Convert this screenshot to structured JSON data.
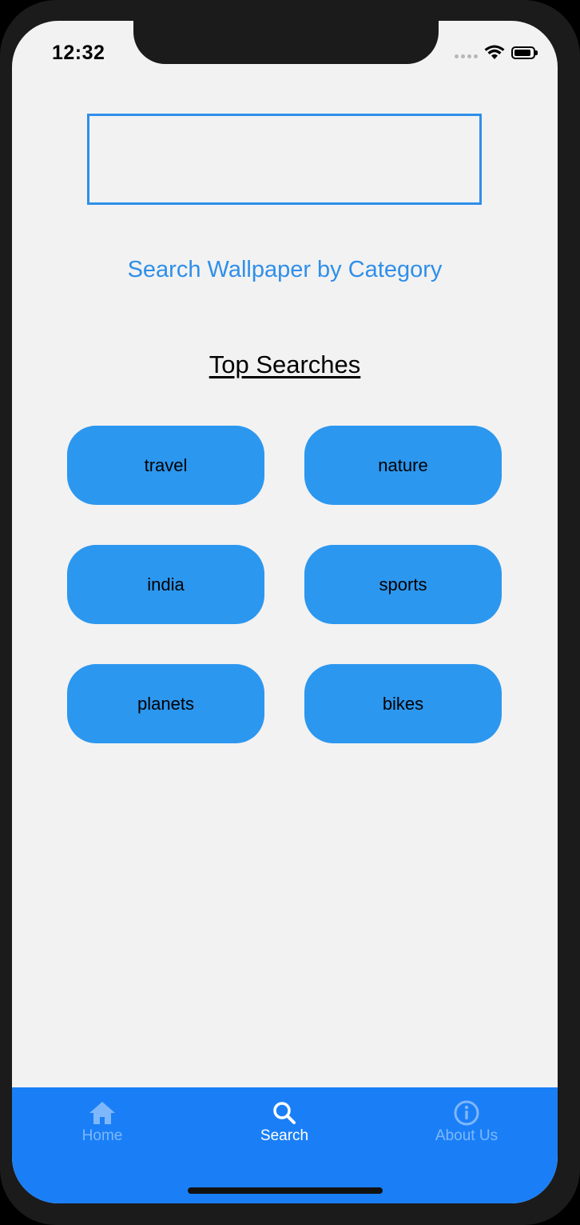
{
  "status_bar": {
    "time": "12:32",
    "icons": [
      "signal-dots-icon",
      "wifi-icon",
      "battery-icon"
    ]
  },
  "search": {
    "value": "",
    "placeholder": ""
  },
  "category_link": "Search Wallpaper by Category",
  "top_searches": {
    "title": "Top Searches",
    "chips": [
      "travel",
      "nature",
      "india",
      "sports",
      "planets",
      "bikes"
    ]
  },
  "tab_bar": {
    "active_tab": "Search",
    "tabs": [
      {
        "label": "Home",
        "icon": "home-icon"
      },
      {
        "label": "Search",
        "icon": "search-icon"
      },
      {
        "label": "About Us",
        "icon": "info-icon"
      }
    ]
  },
  "colors": {
    "accent": "#2f8fe9",
    "chip": "#2c97ef",
    "tab_bar": "#1a7ff7",
    "tab_inactive": "#7fb7fb",
    "tab_active": "#ffffff",
    "background": "#f2f2f2"
  }
}
